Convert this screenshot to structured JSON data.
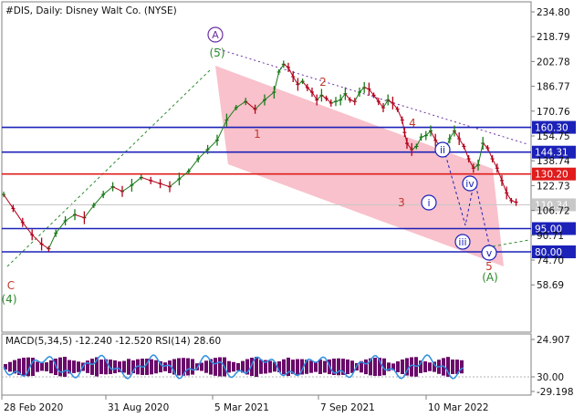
{
  "header": {
    "symbol": "#DIS",
    "timeframe": "Daily:",
    "instrument": "Disney Walt Co. (NYSE)"
  },
  "chart_data": {
    "type": "line",
    "title": "#DIS, Daily: Disney Walt Co. (NYSE)",
    "ylim": [
      53.0,
      240.0
    ],
    "y_ticks": [
      "234.80",
      "218.79",
      "202.78",
      "186.77",
      "170.76",
      "154.75",
      "138.74",
      "122.73",
      "106.72",
      "90.71",
      "74.70",
      "58.69"
    ],
    "x_ticks": [
      "28 Feb 2020",
      "31 Aug 2020",
      "5 Mar 2021",
      "7 Sep 2021",
      "10 Mar 2022"
    ],
    "grid": true,
    "price_series": {
      "name": "DIS",
      "points": [
        [
          0.0,
          117
        ],
        [
          0.02,
          108
        ],
        [
          0.04,
          99
        ],
        [
          0.06,
          91
        ],
        [
          0.08,
          85
        ],
        [
          0.095,
          82
        ],
        [
          0.11,
          92
        ],
        [
          0.13,
          100
        ],
        [
          0.15,
          104
        ],
        [
          0.17,
          102
        ],
        [
          0.19,
          110
        ],
        [
          0.21,
          117
        ],
        [
          0.23,
          122
        ],
        [
          0.25,
          119
        ],
        [
          0.27,
          123
        ],
        [
          0.29,
          128
        ],
        [
          0.31,
          126
        ],
        [
          0.33,
          124
        ],
        [
          0.35,
          122
        ],
        [
          0.37,
          127
        ],
        [
          0.39,
          132
        ],
        [
          0.41,
          140
        ],
        [
          0.43,
          146
        ],
        [
          0.45,
          152
        ],
        [
          0.47,
          165
        ],
        [
          0.49,
          173
        ],
        [
          0.51,
          177
        ],
        [
          0.53,
          172
        ],
        [
          0.55,
          178
        ],
        [
          0.57,
          183
        ],
        [
          0.58,
          196
        ],
        [
          0.59,
          201
        ],
        [
          0.6,
          199
        ],
        [
          0.61,
          193
        ],
        [
          0.62,
          188
        ],
        [
          0.63,
          190
        ],
        [
          0.64,
          186
        ],
        [
          0.65,
          183
        ],
        [
          0.66,
          178
        ],
        [
          0.67,
          181
        ],
        [
          0.68,
          179
        ],
        [
          0.69,
          176
        ],
        [
          0.7,
          177
        ],
        [
          0.71,
          178
        ],
        [
          0.72,
          182
        ],
        [
          0.73,
          178
        ],
        [
          0.74,
          177
        ],
        [
          0.75,
          183
        ],
        [
          0.76,
          186
        ],
        [
          0.77,
          185
        ],
        [
          0.78,
          181
        ],
        [
          0.79,
          177
        ],
        [
          0.8,
          173
        ],
        [
          0.81,
          178
        ],
        [
          0.82,
          176
        ],
        [
          0.83,
          172
        ],
        [
          0.84,
          165
        ],
        [
          0.845,
          157
        ],
        [
          0.85,
          150
        ],
        [
          0.86,
          146
        ],
        [
          0.87,
          148
        ],
        [
          0.88,
          154
        ],
        [
          0.89,
          155
        ],
        [
          0.9,
          158
        ],
        [
          0.91,
          152
        ],
        [
          0.92,
          148
        ],
        [
          0.93,
          145
        ],
        [
          0.94,
          153
        ],
        [
          0.95,
          158
        ],
        [
          0.96,
          153
        ],
        [
          0.97,
          148
        ],
        [
          0.98,
          140
        ],
        [
          0.99,
          134
        ],
        [
          1.0,
          136
        ],
        [
          1.01,
          150
        ],
        [
          1.02,
          147
        ],
        [
          1.03,
          140
        ],
        [
          1.04,
          134
        ],
        [
          1.05,
          126
        ],
        [
          1.06,
          118
        ],
        [
          1.07,
          113
        ],
        [
          1.08,
          112
        ]
      ]
    },
    "horizontal_levels": [
      {
        "value": 160.3,
        "label": "160.30",
        "color": "#1c22b8"
      },
      {
        "value": 144.31,
        "label": "144.31",
        "color": "#1c22b8"
      },
      {
        "value": 130.2,
        "label": "130.20",
        "color": "#e01c1c"
      },
      {
        "value": 110.34,
        "label": "110.34",
        "color": "#c8c8c8"
      },
      {
        "value": 95.0,
        "label": "95.00",
        "color": "#1c22b8"
      },
      {
        "value": 80.0,
        "label": "80.00",
        "color": "#1c22b8"
      }
    ],
    "wave_labels": [
      {
        "text": "A",
        "circled": true,
        "color": "#6b2fa0"
      },
      {
        "text": "(5)",
        "circled": false,
        "color": "#2a8a2a"
      },
      {
        "text": "2",
        "circled": false,
        "color": "#c0392b"
      },
      {
        "text": "1",
        "circled": false,
        "color": "#c0392b"
      },
      {
        "text": "4",
        "circled": false,
        "color": "#c0392b"
      },
      {
        "text": "3",
        "circled": false,
        "color": "#c0392b"
      },
      {
        "text": "5",
        "circled": false,
        "color": "#c0392b"
      },
      {
        "text": "ii",
        "circled": true,
        "color": "#1c22b8"
      },
      {
        "text": "i",
        "circled": true,
        "color": "#1c22b8"
      },
      {
        "text": "iv",
        "circled": true,
        "color": "#1c22b8"
      },
      {
        "text": "iii",
        "circled": true,
        "color": "#1c22b8"
      },
      {
        "text": "v",
        "circled": true,
        "color": "#1c22b8"
      },
      {
        "text": "(A)",
        "circled": false,
        "color": "#2a8a2a"
      },
      {
        "text": "C",
        "circled": false,
        "color": "#c0392b"
      },
      {
        "text": "(4)",
        "circled": false,
        "color": "#2a8a2a"
      }
    ],
    "indicator": {
      "label": "MACD(5,34,5) -12.240 -12.520 RSI(14) 28.60",
      "y_ticks": [
        "24.907",
        "30.00",
        "-29.198"
      ],
      "macd_color": "#6a0a6a",
      "rsi_color": "#2f8fe0"
    }
  },
  "colors": {
    "channel": "#f7b6c2",
    "candle": "#1a7a1a",
    "price_red": "#b3001b",
    "panel_border": "#808080"
  }
}
